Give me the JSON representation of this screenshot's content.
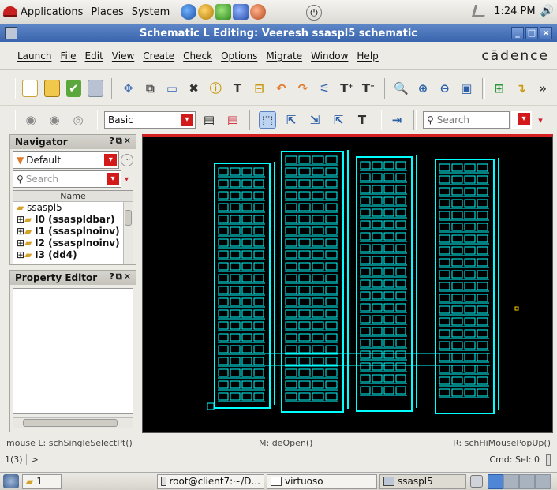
{
  "top_panel": {
    "menus": [
      "Applications",
      "Places",
      "System"
    ],
    "time": "1:24 PM"
  },
  "window": {
    "title": "Schematic L Editing: Veeresh ssaspl5 schematic"
  },
  "menubar": {
    "items": [
      "Launch",
      "File",
      "Edit",
      "View",
      "Create",
      "Check",
      "Options",
      "Migrate",
      "Window",
      "Help"
    ],
    "brand": "cādence"
  },
  "toolbar2": {
    "workspace": "Basic",
    "search_placeholder": "Search"
  },
  "navigator": {
    "title": "Navigator",
    "filter": "Default",
    "search_placeholder": "Search",
    "column": "Name",
    "tree": [
      "ssaspl5",
      "I0 (ssaspldbar)",
      "I1 (ssasplnoinv)",
      "I2 (ssasplnoinv)",
      "I3 (dd4)"
    ]
  },
  "property_editor": {
    "title": "Property Editor"
  },
  "status": {
    "left": "mouse L: schSingleSelectPt()",
    "middle": "M: deOpen()",
    "right": "R: schHiMousePopUp()",
    "count": "1(3)",
    "prompt": ">",
    "cmd": "Cmd: Sel: 0"
  },
  "taskbar": {
    "workspace": "1",
    "tasks": [
      "root@client7:~/D...",
      "virtuoso",
      "ssaspl5"
    ]
  },
  "colors": {
    "wire": "#00ffff",
    "canvas": "#000000",
    "title_bar": "#3a65ad",
    "accent_red": "#d21a1a"
  }
}
